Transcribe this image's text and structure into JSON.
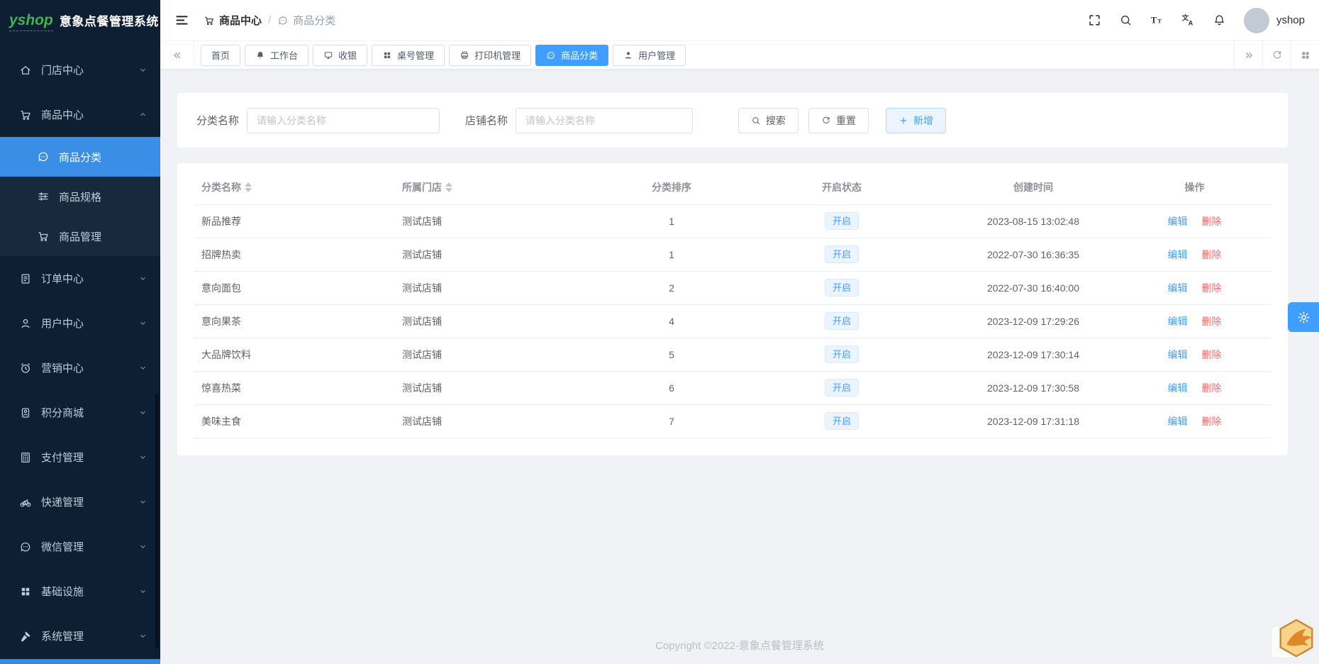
{
  "app": {
    "logo_text": "yshop",
    "title": "意象点餐管理系统",
    "user_name": "yshop"
  },
  "breadcrumb": {
    "section": "商品中心",
    "separator": "/",
    "page": "商品分类"
  },
  "sidebar": {
    "items": [
      {
        "label": "门店中心",
        "icon": "home",
        "chevron": "chevron-down",
        "type": "item"
      },
      {
        "label": "商品中心",
        "icon": "cart",
        "chevron": "chevron-up",
        "type": "item"
      },
      {
        "label": "商品分类",
        "icon": "chat",
        "type": "sub",
        "active": true
      },
      {
        "label": "商品规格",
        "icon": "sliders",
        "type": "sub"
      },
      {
        "label": "商品管理",
        "icon": "cart",
        "type": "sub"
      },
      {
        "label": "订单中心",
        "icon": "order",
        "chevron": "chevron-down",
        "type": "item"
      },
      {
        "label": "用户中心",
        "icon": "user",
        "chevron": "chevron-down",
        "type": "item"
      },
      {
        "label": "营销中心",
        "icon": "alarm",
        "chevron": "chevron-down",
        "type": "item"
      },
      {
        "label": "积分商城",
        "icon": "medal",
        "chevron": "chevron-down",
        "type": "item"
      },
      {
        "label": "支付管理",
        "icon": "calculator",
        "chevron": "chevron-down",
        "type": "item"
      },
      {
        "label": "快递管理",
        "icon": "bike",
        "chevron": "chevron-down",
        "type": "item"
      },
      {
        "label": "微信管理",
        "icon": "wechat",
        "chevron": "chevron-down",
        "type": "item"
      },
      {
        "label": "基础设施",
        "icon": "grid",
        "chevron": "chevron-down",
        "type": "item"
      },
      {
        "label": "系统管理",
        "icon": "hammer",
        "chevron": "chevron-down",
        "type": "item"
      }
    ]
  },
  "tabs": {
    "items": [
      {
        "label": "首页"
      },
      {
        "label": "工作台",
        "icon": "bell-filled"
      },
      {
        "label": "收银",
        "icon": "monitor"
      },
      {
        "label": "桌号管理",
        "icon": "grid"
      },
      {
        "label": "打印机管理",
        "icon": "printer"
      },
      {
        "label": "商品分类",
        "icon": "chat",
        "active": true
      },
      {
        "label": "用户管理",
        "icon": "user-filled"
      }
    ]
  },
  "search": {
    "category_label": "分类名称",
    "category_placeholder": "请输入分类名称",
    "category_value": "",
    "shop_label": "店铺名称",
    "shop_placeholder": "请输入分类名称",
    "shop_value": "",
    "search_label": "搜索",
    "reset_label": "重置",
    "add_label": "新增"
  },
  "table": {
    "columns": [
      {
        "label": "分类名称",
        "sortable": true,
        "align": "left"
      },
      {
        "label": "所属门店",
        "sortable": true,
        "align": "left"
      },
      {
        "label": "分类排序",
        "align": "center"
      },
      {
        "label": "开启状态",
        "align": "center"
      },
      {
        "label": "创建时间",
        "align": "center"
      },
      {
        "label": "操作",
        "align": "center"
      }
    ],
    "rows": [
      {
        "name": "新品推荐",
        "shop": "测试店铺",
        "sort": "1",
        "status": "开启",
        "created": "2023-08-15 13:02:48"
      },
      {
        "name": "招牌热卖",
        "shop": "测试店铺",
        "sort": "1",
        "status": "开启",
        "created": "2022-07-30 16:36:35"
      },
      {
        "name": "意向面包",
        "shop": "测试店铺",
        "sort": "2",
        "status": "开启",
        "created": "2022-07-30 16:40:00"
      },
      {
        "name": "意向果茶",
        "shop": "测试店铺",
        "sort": "4",
        "status": "开启",
        "created": "2023-12-09 17:29:26"
      },
      {
        "name": "大品牌饮料",
        "shop": "测试店铺",
        "sort": "5",
        "status": "开启",
        "created": "2023-12-09 17:30:14"
      },
      {
        "name": "惊喜热菜",
        "shop": "测试店铺",
        "sort": "6",
        "status": "开启",
        "created": "2023-12-09 17:30:58"
      },
      {
        "name": "美味主食",
        "shop": "测试店铺",
        "sort": "7",
        "status": "开启",
        "created": "2023-12-09 17:31:18"
      }
    ],
    "actions": {
      "edit": "编辑",
      "delete": "删除"
    }
  },
  "footer": {
    "copyright": "Copyright ©2022-意象点餐管理系统"
  },
  "colors": {
    "primary": "#409eff",
    "danger": "#f56c6c",
    "sidebar_bg": "#0f1f33",
    "submenu_bg": "#18293e",
    "active_menu": "#3a8ee6",
    "badge_bg": "#ecf5ff",
    "logo_green": "#3eb550"
  }
}
